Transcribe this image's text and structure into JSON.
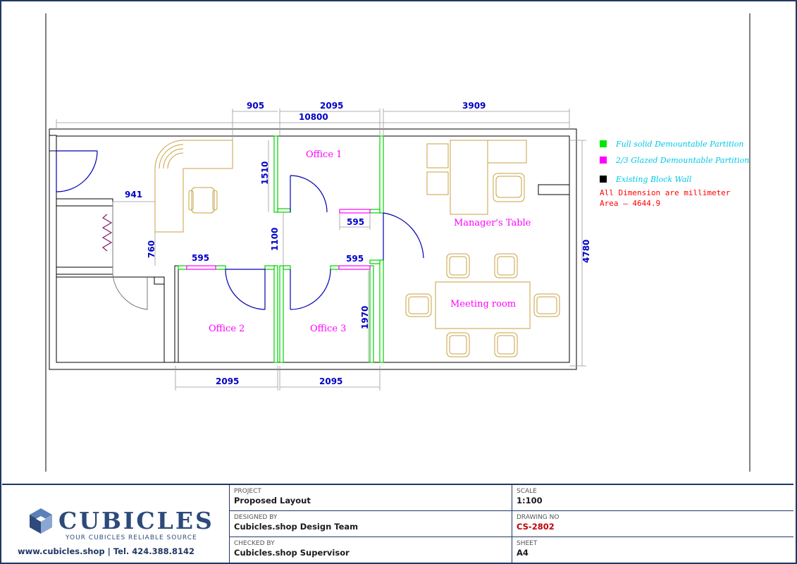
{
  "drawing": {
    "dimensions": {
      "d905": "905",
      "d2095_top": "2095",
      "d10800": "10800",
      "d3909": "3909",
      "d941": "941",
      "d1510": "1510",
      "d760": "760",
      "d1100": "1100",
      "d595_a": "595",
      "d595_b": "595",
      "d595_c": "595",
      "d1970": "1970",
      "d4780": "4780",
      "d2095_bl": "2095",
      "d2095_br": "2095"
    },
    "rooms": {
      "office1": "Office 1",
      "office2": "Office 2",
      "office3": "Office 3",
      "manager": "Manager's Table",
      "meeting": "Meeting room"
    }
  },
  "legend": {
    "items": [
      {
        "label": "Full solid Demountable Partition",
        "color": "#00e600"
      },
      {
        "label": "2/3 Glazed Demountable Partition",
        "color": "#ff00ff"
      },
      {
        "label": "Existing Block Wall",
        "color": "#000000"
      }
    ],
    "note_dimension": "All Dimension are millimeter",
    "note_area": "Area  —  4644.9"
  },
  "titleblock": {
    "brand": "CUBICLES",
    "tagline": "YOUR CUBICLES RELIABLE SOURCE",
    "contact": "www.cubicles.shop   |   Tel. 424.388.8142",
    "project_label": "PROJECT",
    "project_value": "Proposed Layout",
    "designed_label": "DESIGNED BY",
    "designed_value": "Cubicles.shop Design Team",
    "checked_label": "CHECKED BY",
    "checked_value": "Cubicles.shop Supervisor",
    "scale_label": "SCALE",
    "scale_value": "1:100",
    "drawing_no_label": "DRAWING NO",
    "drawing_no_value": "CS-2802",
    "sheet_label": "SHEET",
    "sheet_value": "A4"
  },
  "colors": {
    "frame": "#1f3864",
    "dimension_text": "#0000c8",
    "room_text": "#ff00ff",
    "furniture": "#c8a040",
    "door_swing": "#0000b4",
    "solid_partition": "#00e600",
    "glazed_partition": "#ff00ff",
    "legend_text": "#00c8e6",
    "note_text": "#ff0000"
  }
}
